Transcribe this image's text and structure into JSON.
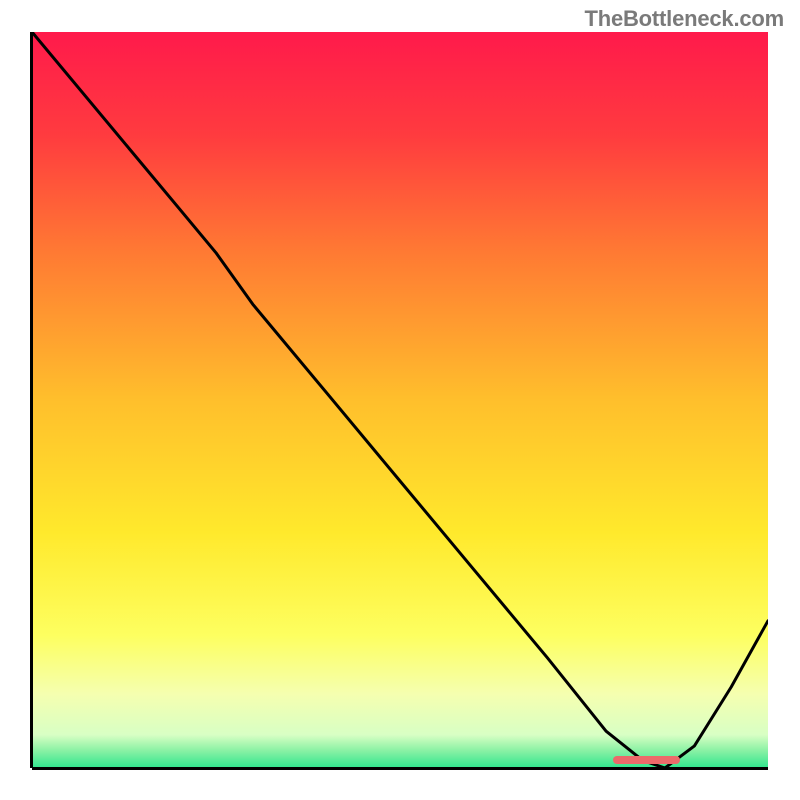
{
  "watermark": "TheBottleneck.com",
  "chart_data": {
    "type": "line",
    "title": "",
    "xlabel": "",
    "ylabel": "",
    "xlim": [
      0,
      100
    ],
    "ylim": [
      0,
      100
    ],
    "grid": false,
    "legend": false,
    "series": [
      {
        "name": "bottleneck-curve",
        "x": [
          0,
          10,
          20,
          25,
          30,
          40,
          50,
          60,
          70,
          78,
          83,
          86,
          90,
          95,
          100
        ],
        "y": [
          100,
          88,
          76,
          70,
          63,
          51,
          39,
          27,
          15,
          5,
          1,
          0,
          3,
          11,
          20
        ],
        "color": "#000000"
      }
    ],
    "highlight_segment": {
      "name": "near-zero-band",
      "x_start": 79,
      "x_end": 88,
      "color": "#ec6a6a"
    },
    "background_gradient": {
      "stops": [
        {
          "pos": 0.0,
          "color": "#ff1a4b"
        },
        {
          "pos": 0.14,
          "color": "#ff3b3f"
        },
        {
          "pos": 0.3,
          "color": "#ff7a33"
        },
        {
          "pos": 0.5,
          "color": "#ffbf2c"
        },
        {
          "pos": 0.68,
          "color": "#ffe92c"
        },
        {
          "pos": 0.82,
          "color": "#fdff60"
        },
        {
          "pos": 0.9,
          "color": "#f5ffb0"
        },
        {
          "pos": 0.955,
          "color": "#d8ffc4"
        },
        {
          "pos": 0.975,
          "color": "#8ff2a6"
        },
        {
          "pos": 1.0,
          "color": "#2fe58e"
        }
      ]
    }
  }
}
